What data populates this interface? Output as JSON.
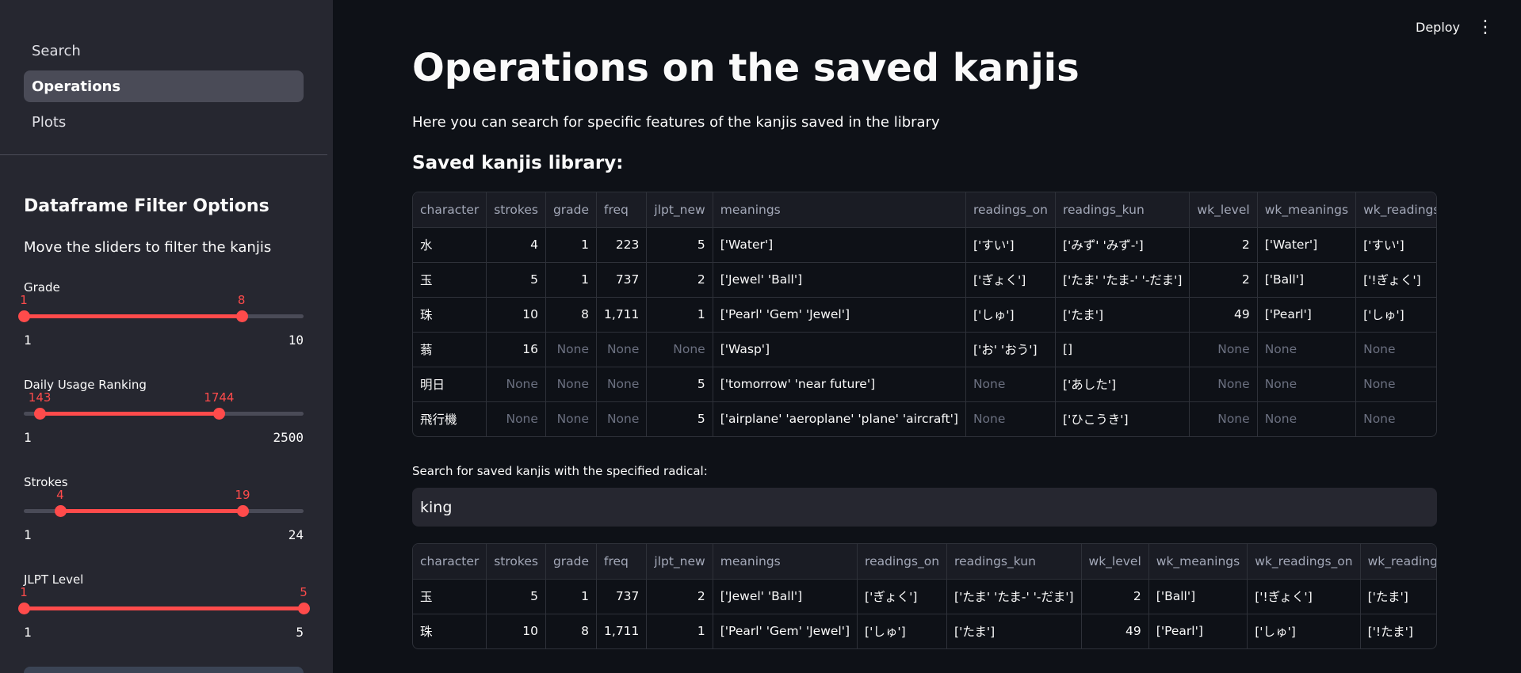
{
  "sidebar": {
    "nav": [
      {
        "label": "Search",
        "active": false
      },
      {
        "label": "Operations",
        "active": true
      },
      {
        "label": "Plots",
        "active": false
      }
    ],
    "filter_title": "Dataframe Filter Options",
    "filter_desc": "Move the sliders to filter the kanjis",
    "sliders": [
      {
        "label": "Grade",
        "low": "1",
        "high": "8",
        "min": "1",
        "max": "10"
      },
      {
        "label": "Daily Usage Ranking",
        "low": "143",
        "high": "1744",
        "min": "1",
        "max": "2500"
      },
      {
        "label": "Strokes",
        "low": "4",
        "high": "19",
        "min": "1",
        "max": "24"
      },
      {
        "label": "JLPT Level",
        "low": "1",
        "high": "5",
        "min": "1",
        "max": "5"
      }
    ]
  },
  "topbar": {
    "deploy": "Deploy",
    "menu_icon": "⋮"
  },
  "main": {
    "title": "Operations on the saved kanjis",
    "intro": "Here you can search for specific features of the kanjis saved in the library",
    "library_header": "Saved kanjis library:",
    "search_label": "Search for saved kanjis with the specified radical:",
    "search_value": "king"
  },
  "colors": {
    "accent": "#ff4b4b",
    "sidebar_bg": "#262730",
    "main_bg": "#0e1117"
  },
  "library_table": {
    "columns": [
      "character",
      "strokes",
      "grade",
      "freq",
      "jlpt_new",
      "meanings",
      "readings_on",
      "readings_kun",
      "wk_level",
      "wk_meanings",
      "wk_readings_o"
    ],
    "rows": [
      [
        "水",
        "4",
        "1",
        "223",
        "5",
        "['Water']",
        "['すい']",
        "['みず' 'みず-']",
        "2",
        "['Water']",
        "['すい']"
      ],
      [
        "玉",
        "5",
        "1",
        "737",
        "2",
        "['Jewel' 'Ball']",
        "['ぎょく']",
        "['たま' 'たま-' '-だま']",
        "2",
        "['Ball']",
        "['!ぎょく']"
      ],
      [
        "珠",
        "10",
        "8",
        "1,711",
        "1",
        "['Pearl' 'Gem' 'Jewel']",
        "['しゅ']",
        "['たま']",
        "49",
        "['Pearl']",
        "['しゅ']"
      ],
      [
        "蓊",
        "16",
        "None",
        "None",
        "None",
        "['Wasp']",
        "['お' 'おう']",
        "[]",
        "None",
        "None",
        "None"
      ],
      [
        "明日",
        "None",
        "None",
        "None",
        "5",
        "['tomorrow' 'near future']",
        "None",
        "['あした']",
        "None",
        "None",
        "None"
      ],
      [
        "飛行機",
        "None",
        "None",
        "None",
        "5",
        "['airplane' 'aeroplane' 'plane' 'aircraft']",
        "None",
        "['ひこうき']",
        "None",
        "None",
        "None"
      ]
    ]
  },
  "radical_table": {
    "columns": [
      "character",
      "strokes",
      "grade",
      "freq",
      "jlpt_new",
      "meanings",
      "readings_on",
      "readings_kun",
      "wk_level",
      "wk_meanings",
      "wk_readings_on",
      "wk_readings"
    ],
    "rows": [
      [
        "玉",
        "5",
        "1",
        "737",
        "2",
        "['Jewel' 'Ball']",
        "['ぎょく']",
        "['たま' 'たま-' '-だま']",
        "2",
        "['Ball']",
        "['!ぎょく']",
        "['たま']"
      ],
      [
        "珠",
        "10",
        "8",
        "1,711",
        "1",
        "['Pearl' 'Gem' 'Jewel']",
        "['しゅ']",
        "['たま']",
        "49",
        "['Pearl']",
        "['しゅ']",
        "['!たま']"
      ]
    ]
  }
}
